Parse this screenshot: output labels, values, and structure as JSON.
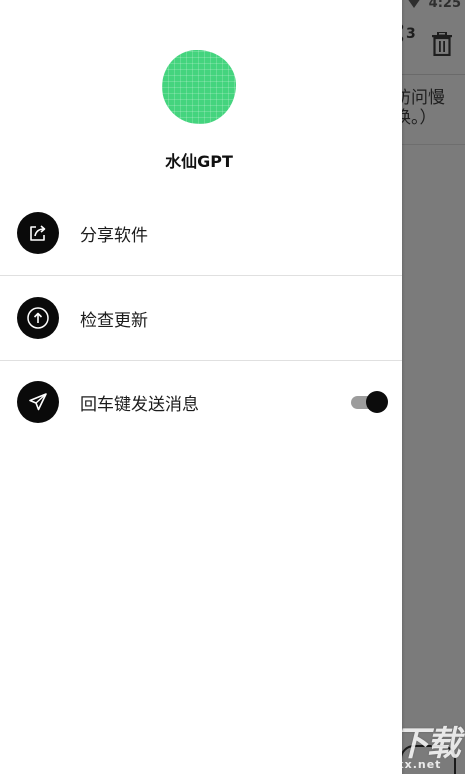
{
  "status_bar": {
    "time": "4:25"
  },
  "background_app": {
    "share_count": "3",
    "notice_line1": "访问慢",
    "notice_line2": "换。）"
  },
  "drawer": {
    "app_name": "水仙GPT",
    "menu": [
      {
        "label": "分享软件",
        "icon": "share-icon"
      },
      {
        "label": "检查更新",
        "icon": "upload-arrow-icon"
      },
      {
        "label": "回车键发送消息",
        "icon": "send-icon",
        "toggle": true,
        "toggle_on": true
      }
    ]
  },
  "watermark": {
    "logo_text": "KK下载",
    "url": "www.kkx.net"
  },
  "colors": {
    "avatar_green": "#44d47e",
    "icon_bg": "#0a0a0a",
    "scrim": "#7b7b7b"
  }
}
